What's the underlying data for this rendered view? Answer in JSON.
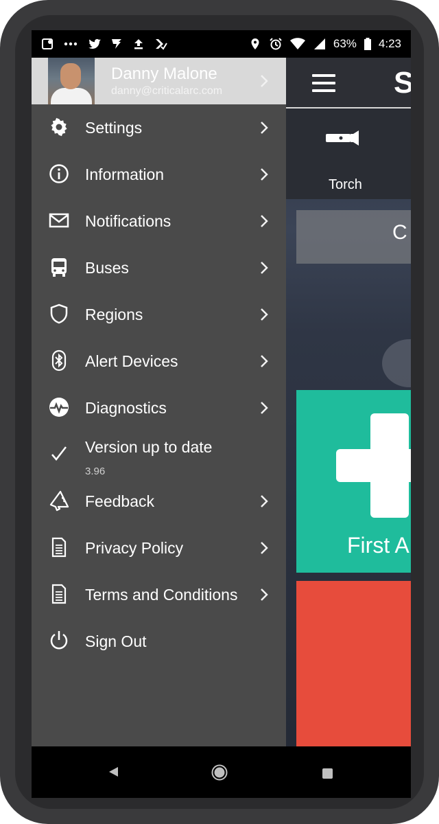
{
  "status_bar": {
    "battery_percent": "63%",
    "time": "4:23"
  },
  "profile": {
    "name": "Danny Malone",
    "email": "danny@criticalarc.com"
  },
  "menu": {
    "items": [
      {
        "label": "Settings",
        "icon": "gear-icon",
        "has_chevron": true
      },
      {
        "label": "Information",
        "icon": "info-icon",
        "has_chevron": true
      },
      {
        "label": "Notifications",
        "icon": "envelope-icon",
        "has_chevron": true
      },
      {
        "label": "Buses",
        "icon": "bus-icon",
        "has_chevron": true
      },
      {
        "label": "Regions",
        "icon": "shield-icon",
        "has_chevron": true
      },
      {
        "label": "Alert Devices",
        "icon": "bluetooth-icon",
        "has_chevron": true
      },
      {
        "label": "Diagnostics",
        "icon": "pulse-icon",
        "has_chevron": true
      },
      {
        "label": "Version up to date",
        "sublabel": "3.96",
        "icon": "checkmark-icon",
        "has_chevron": false
      },
      {
        "label": "Feedback",
        "icon": "megaphone-icon",
        "has_chevron": true
      },
      {
        "label": "Privacy Policy",
        "icon": "document-icon",
        "has_chevron": true
      },
      {
        "label": "Terms and Conditions",
        "icon": "document-icon",
        "has_chevron": true
      },
      {
        "label": "Sign Out",
        "icon": "power-icon",
        "has_chevron": false
      }
    ]
  },
  "app": {
    "logo_letter": "S",
    "torch_label": "Torch",
    "search_letter": "C",
    "first_aid_label": "First A"
  },
  "colors": {
    "drawer_bg": "#4a4a4a",
    "profile_bg": "#d9d9d9",
    "first_aid_tile": "#1fbc9c",
    "alert_tile": "#e74c3c"
  }
}
